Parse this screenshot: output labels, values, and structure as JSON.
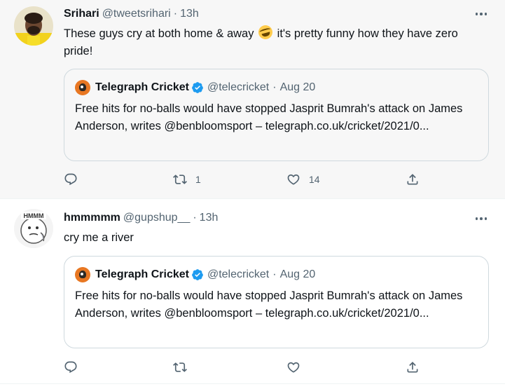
{
  "tweets": [
    {
      "display_name": "Srihari",
      "handle": "@tweetsrihari",
      "separator": "·",
      "time": "13h",
      "text_before_emoji": "These guys cry at both home & away ",
      "emoji": "rolling-on-floor-laughing-emoji",
      "text_after_emoji": " it's pretty funny how they have zero pride!",
      "quote": {
        "display_name": "Telegraph Cricket",
        "handle": "@telecricket",
        "separator": "·",
        "date": "Aug 20",
        "text": "Free hits for no-balls would have stopped Jasprit Bumrah's attack on James Anderson, writes @benbloomsport – telegraph.co.uk/cricket/2021/0..."
      },
      "actions": {
        "reply_count": "",
        "retweet_count": "1",
        "like_count": "14"
      }
    },
    {
      "display_name": "hmmmmm",
      "handle": "@gupshup__",
      "separator": "·",
      "time": "13h",
      "text": "cry me a river",
      "avatar_lettering": "HMMM",
      "quote": {
        "display_name": "Telegraph Cricket",
        "handle": "@telecricket",
        "separator": "·",
        "date": "Aug 20",
        "text": "Free hits for no-balls would have stopped Jasprit Bumrah's attack on James Anderson, writes @benbloomsport – telegraph.co.uk/cricket/2021/0..."
      },
      "actions": {
        "reply_count": "",
        "retweet_count": "",
        "like_count": ""
      }
    }
  ],
  "colors": {
    "text_primary": "#0f1419",
    "text_secondary": "#536471",
    "border": "#cfd9de",
    "verified_blue": "#1d9bf0",
    "hover_bg": "#f7f7f7"
  }
}
